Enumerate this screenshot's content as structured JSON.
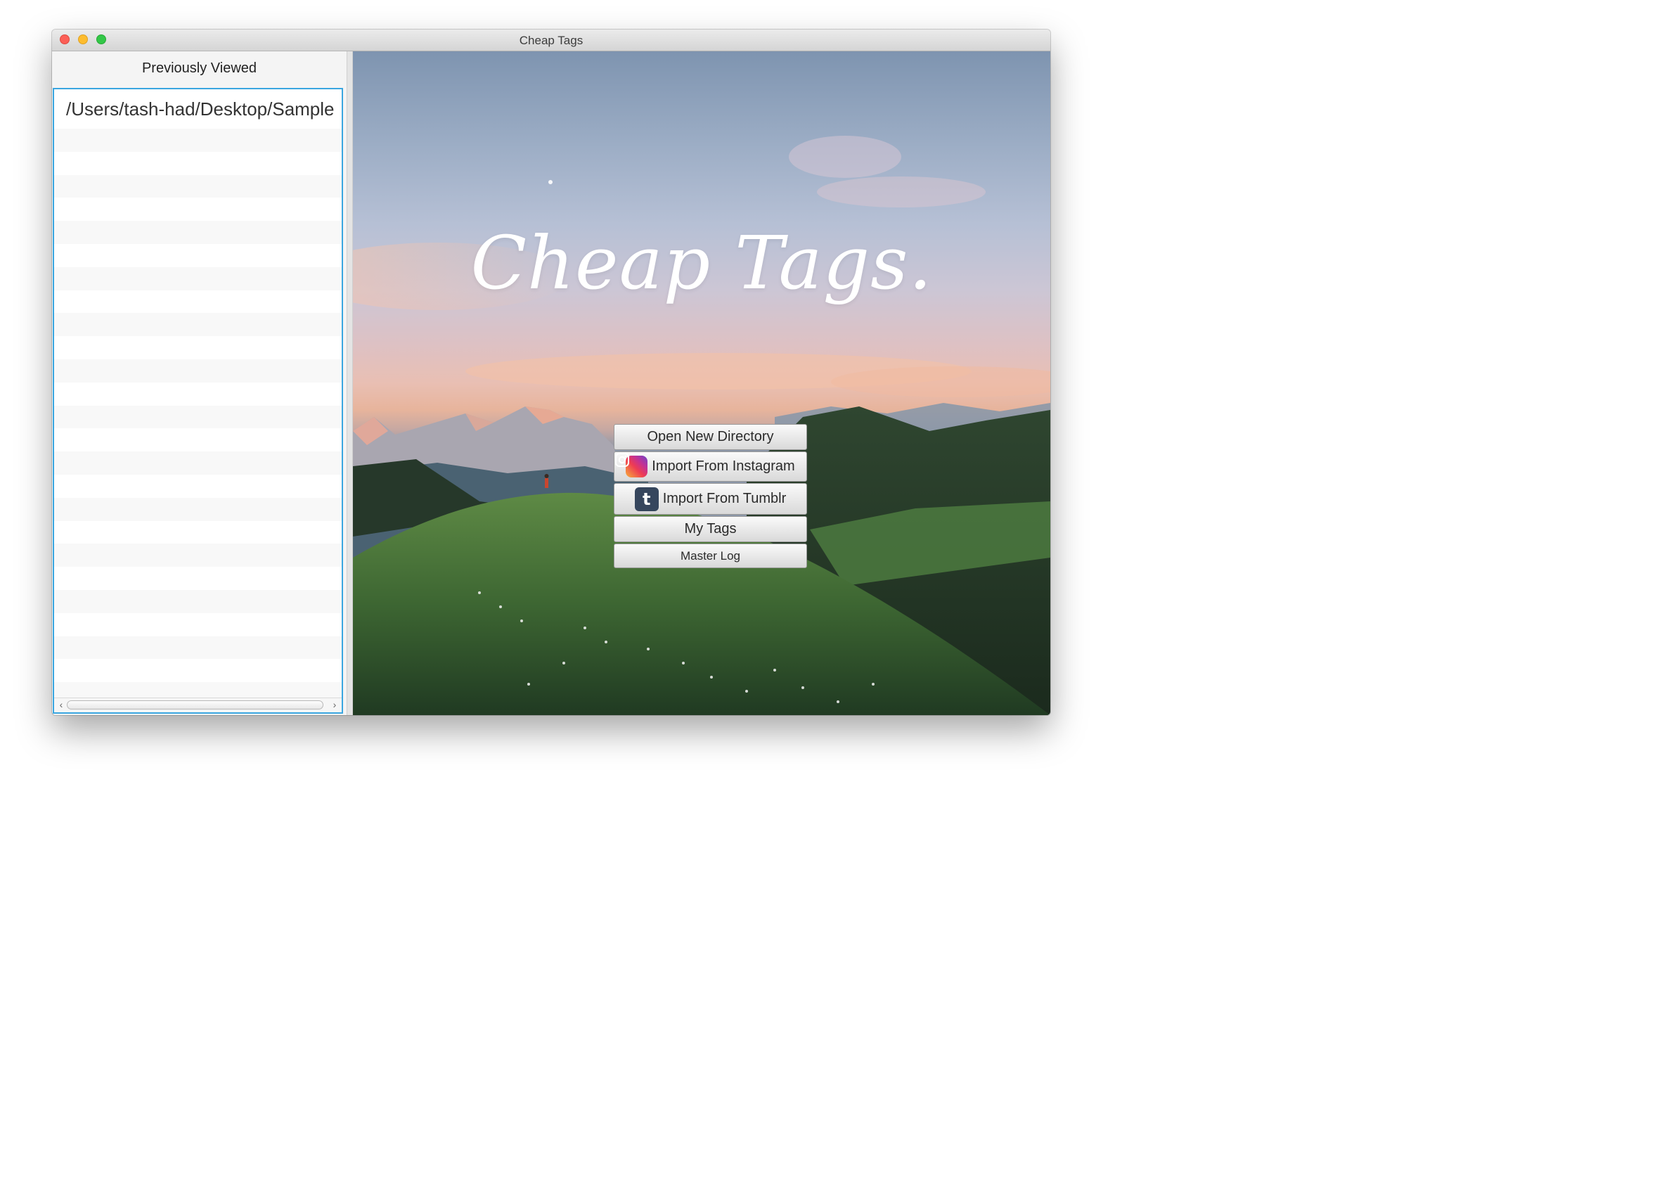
{
  "window": {
    "title": "Cheap Tags"
  },
  "sidebar": {
    "header": "Previously Viewed",
    "items": [
      {
        "label": "/Users/tash-had/Desktop/Sample"
      }
    ]
  },
  "hero": {
    "title": "Cheap Tags."
  },
  "menu": {
    "open_directory": "Open New Directory",
    "import_instagram": "Import From Instagram",
    "import_tumblr": "Import From Tumblr",
    "my_tags": "My Tags",
    "master_log": "Master Log"
  },
  "icons": {
    "instagram": "instagram-icon",
    "tumblr": "tumblr-icon"
  }
}
